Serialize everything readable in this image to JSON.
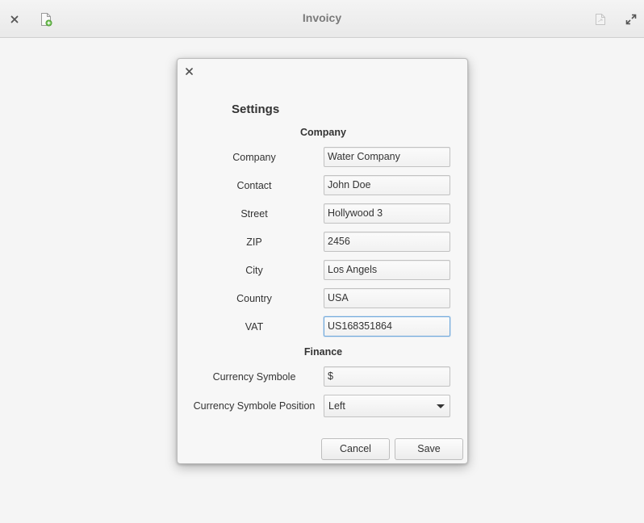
{
  "window": {
    "title": "Invoicy"
  },
  "icons": {
    "close": "close-icon",
    "new_document": "new-document-icon",
    "document": "document-icon",
    "fullscreen": "fullscreen-icon"
  },
  "colors": {
    "accent": "#6fa8dc",
    "new_doc_badge": "#6cbf4f"
  },
  "dialog": {
    "title": "Settings",
    "company_section": "Company",
    "finance_section": "Finance",
    "fields": {
      "company": {
        "label": "Company",
        "value": "Water Company"
      },
      "contact": {
        "label": "Contact",
        "value": "John Doe"
      },
      "street": {
        "label": "Street",
        "value": "Hollywood 3"
      },
      "zip": {
        "label": "ZIP",
        "value": "2456"
      },
      "city": {
        "label": "City",
        "value": "Los Angels"
      },
      "country": {
        "label": "Country",
        "value": "USA"
      },
      "vat": {
        "label": "VAT",
        "value": "US168351864"
      },
      "currency_symbol": {
        "label": "Currency Symbole",
        "value": "$"
      },
      "currency_position": {
        "label": "Currency Symbole Position",
        "value": "Left"
      }
    },
    "buttons": {
      "cancel": "Cancel",
      "save": "Save"
    }
  }
}
